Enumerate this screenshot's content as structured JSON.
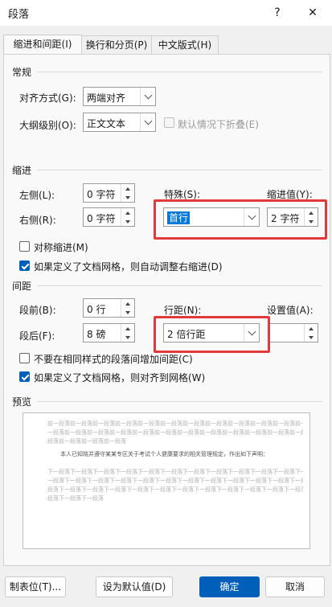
{
  "window": {
    "title": "段落",
    "help_glyph": "?",
    "close_glyph": "✕"
  },
  "tabs": [
    {
      "label": "缩进和间距(I)"
    },
    {
      "label": "换行和分页(P)"
    },
    {
      "label": "中文版式(H)"
    }
  ],
  "general": {
    "heading": "常规",
    "alignment_label": "对齐方式(G):",
    "alignment_value": "两端对齐",
    "outline_label": "大纲级别(O):",
    "outline_value": "正文文本",
    "collapse_label": "默认情况下折叠(E)"
  },
  "indent": {
    "heading": "缩进",
    "left_label": "左侧(L):",
    "left_value": "0 字符",
    "right_label": "右侧(R):",
    "right_value": "0 字符",
    "special_label": "特殊(S):",
    "special_value": "首行",
    "by_label": "缩进值(Y):",
    "by_value": "2 字符",
    "mirror_label": "对称缩进(M)",
    "grid_adjust_label": "如果定义了文档网格，则自动调整右缩进(D)"
  },
  "spacing": {
    "heading": "间距",
    "before_label": "段前(B):",
    "before_value": "0 行",
    "after_label": "段后(F):",
    "after_value": "8 磅",
    "line_label": "行距(N):",
    "line_value": "2 倍行距",
    "at_label": "设置值(A):",
    "at_value": "",
    "no_space_label": "不要在相同样式的段落间增加间距(C)",
    "snap_grid_label": "如果定义了文档网格，则对齐到网格(W)"
  },
  "preview": {
    "heading": "预览",
    "prev_lines": [
      "前一段落前一段落前一段落前一段落前一段落前一段落前一段落前一段落前一段落前一段落前一段落前一段落",
      "一段落前一段落前一段落前一段落前一段落前一段落前一段落前一段落前一段落前一段落前一段落前一段落",
      "段落前一段落前一段落前一段落"
    ],
    "sample_text": "本人已知晓并遵守某某专区关于考试个人健康要求的相关管理规定，作出如下声明：",
    "next_lines": [
      "下一段落下一段落下一段落下一段落下一段落下一段落下一段落下一段落下一段落下一段落下一段落下一段落下",
      "一段落下一段落下一段落下一段落下一段落下一段落下一段落下一段落下一段落下一段落下一段落下一段落下",
      "段落下一段落下一段落下一段落下一段落下一段落下一段落下一段落下一段落下一段落下一段落下一段落下一段落",
      "段落下一段落下一段落"
    ]
  },
  "buttons": {
    "tabs_label": "制表位(T)...",
    "default_label": "设为默认值(D)",
    "ok_label": "确定",
    "cancel_label": "取消"
  },
  "colors": {
    "accent": "#005fb8",
    "highlight_box": "#e23a3a",
    "selection": "#0078d7"
  }
}
